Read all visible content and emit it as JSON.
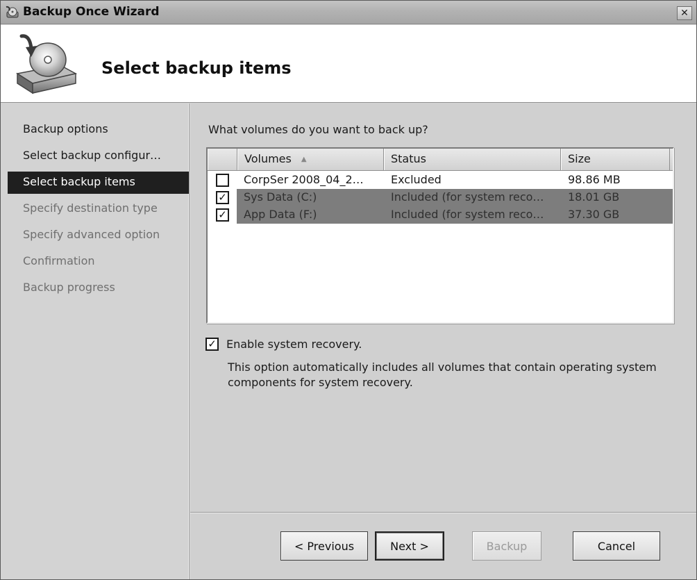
{
  "window": {
    "title": "Backup Once Wizard",
    "close_label": "✕"
  },
  "header": {
    "title": "Select backup items",
    "icon": "backup-disk-icon"
  },
  "nav": {
    "items": [
      {
        "label": "Backup options",
        "state": "normal"
      },
      {
        "label": "Select backup configur…",
        "state": "normal"
      },
      {
        "label": "Select backup items",
        "state": "selected"
      },
      {
        "label": "Specify destination type",
        "state": "disabled"
      },
      {
        "label": "Specify advanced option",
        "state": "disabled"
      },
      {
        "label": "Confirmation",
        "state": "disabled"
      },
      {
        "label": "Backup progress",
        "state": "disabled"
      }
    ]
  },
  "main": {
    "question": "What volumes do you want to back up?",
    "columns": {
      "volumes": "Volumes",
      "status": "Status",
      "size": "Size"
    },
    "rows": [
      {
        "checked": false,
        "volume": "CorpSer 2008_04_2…",
        "status": "Excluded",
        "size": "98.86 MB",
        "selected": false
      },
      {
        "checked": true,
        "volume": "Sys Data (C:)",
        "status": "Included (for system reco…",
        "size": "18.01 GB",
        "selected": true
      },
      {
        "checked": true,
        "volume": "App Data (F:)",
        "status": "Included (for system reco…",
        "size": "37.30 GB",
        "selected": true
      }
    ],
    "recovery": {
      "checked": true,
      "label": "Enable system recovery.",
      "description": "This option automatically includes all volumes that contain operating system components for system recovery."
    }
  },
  "footer": {
    "previous": "< Previous",
    "next": "Next >",
    "backup": "Backup",
    "cancel": "Cancel"
  },
  "check_mark": "✓"
}
